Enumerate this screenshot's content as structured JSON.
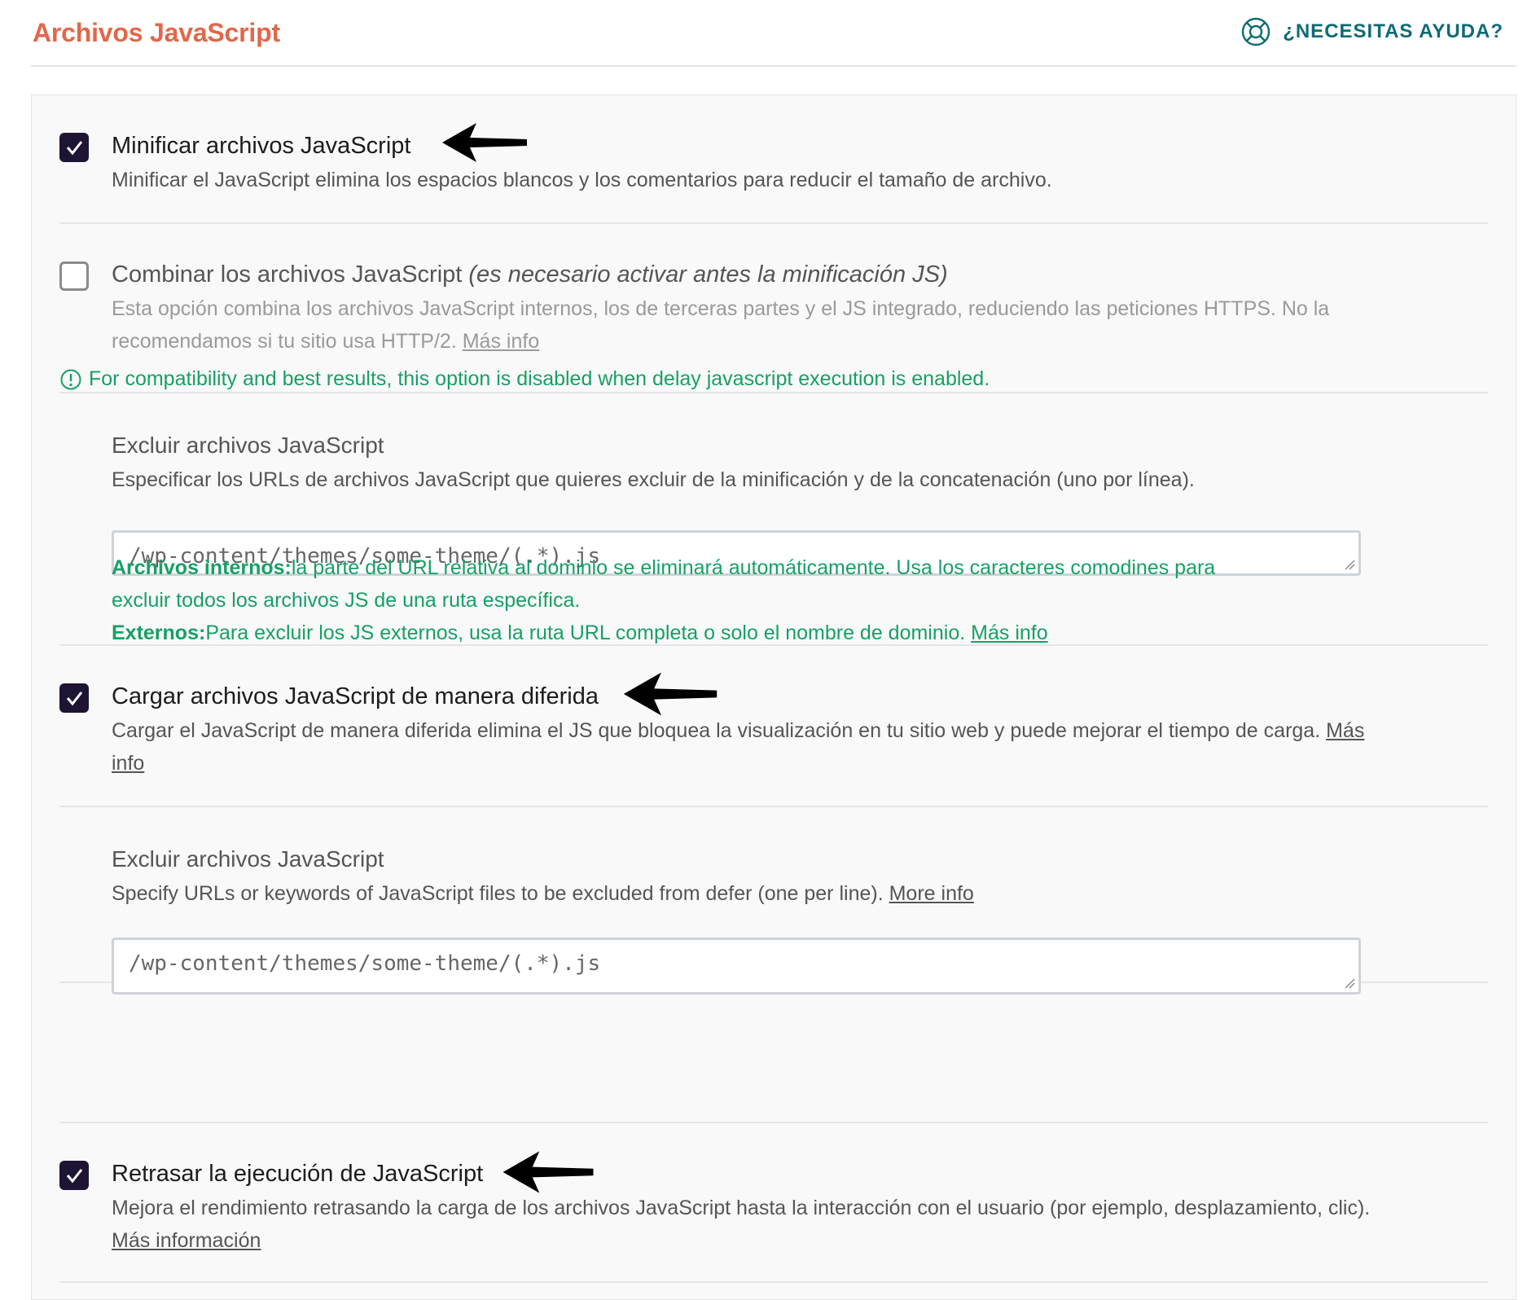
{
  "header": {
    "title": "Archivos JavaScript",
    "help_label": "¿NECESITAS AYUDA?",
    "help_icon": "lifebuoy-icon",
    "title_color": "#e0684b",
    "help_color": "#0e6b75"
  },
  "options": {
    "minify": {
      "checked": true,
      "label": "Minificar archivos JavaScript",
      "description": "Minificar el JavaScript elimina los espacios blancos y los comentarios para reducir el tamaño de archivo."
    },
    "combine": {
      "checked": false,
      "label": "Combinar los archivos JavaScript",
      "label_note": "(es necesario activar antes la minificación JS)",
      "description_line1": "Esta opción combina los archivos JavaScript internos, los de terceras partes y el JS integrado, reduciendo las peticiones HTTPS. No la",
      "description_line2": "recomendamos si tu sitio usa HTTP/2.",
      "more_link": "Más info",
      "notice": "For compatibility and best results, this option is disabled when delay javascript execution is enabled."
    },
    "exclude_minify": {
      "title": "Excluir archivos JavaScript",
      "description": "Especificar los URLs de archivos JavaScript que quieres excluir de la minificación y de la concatenación (uno por línea).",
      "value": "/wp-content/themes/some-theme/(.*).js",
      "help_internal_label": "Archivos internos:",
      "help_internal_line1": "la parte del URL relativa al dominio se eliminará automáticamente. Usa los caracteres comodines para",
      "help_internal_line2": "excluir todos los archivos JS de una ruta específica.",
      "help_external_label": "Externos:",
      "help_external_text": "Para excluir los JS externos, usa la ruta URL completa o solo el nombre de dominio.",
      "more_link": "Más info"
    },
    "defer": {
      "checked": true,
      "label": "Cargar archivos JavaScript de manera diferida",
      "description_line1": "Cargar el JavaScript de manera diferida elimina el JS que bloquea la visualización en tu sitio web y puede mejorar el tiempo de carga.",
      "more_link_part1": "Más",
      "more_link_part2": "info"
    },
    "exclude_defer": {
      "title": "Excluir archivos JavaScript",
      "description": "Specify URLs or keywords of JavaScript files to be excluded from defer (one per line).",
      "more_link": "More info",
      "value": "/wp-content/themes/some-theme/(.*).js"
    },
    "delay": {
      "checked": true,
      "label": "Retrasar la ejecución de JavaScript",
      "description": "Mejora el rendimiento retrasando la carga de los archivos JavaScript hasta la interacción con el usuario (por ejemplo, desplazamiento, clic).",
      "more_link": "Más información"
    }
  },
  "annotations": [
    "arrow-left-icon",
    "arrow-left-icon",
    "arrow-left-icon"
  ],
  "colors": {
    "checkbox_checked": "#1e1433",
    "notice_green": "#17a065",
    "panel_bg": "#f9f9f9"
  }
}
